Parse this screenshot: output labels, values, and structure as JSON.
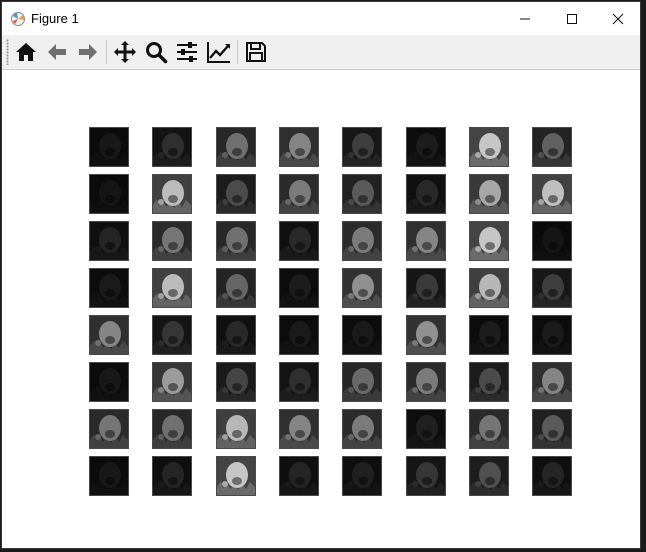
{
  "window": {
    "title": "Figure 1"
  },
  "toolbar": {
    "buttons": [
      {
        "name": "home-icon"
      },
      {
        "name": "back-arrow-icon"
      },
      {
        "name": "forward-arrow-icon"
      },
      {
        "name": "pan-move-icon"
      },
      {
        "name": "zoom-magnifier-icon"
      },
      {
        "name": "configure-subplots-icon"
      },
      {
        "name": "edit-axes-line-icon"
      },
      {
        "name": "save-floppy-icon"
      }
    ]
  },
  "feature_maps": {
    "rows": 8,
    "cols": 8,
    "brightness": [
      [
        0.04,
        0.15,
        0.45,
        0.55,
        0.22,
        0.06,
        0.85,
        0.38
      ],
      [
        0.03,
        0.8,
        0.28,
        0.5,
        0.35,
        0.12,
        0.7,
        0.82
      ],
      [
        0.1,
        0.48,
        0.45,
        0.12,
        0.5,
        0.55,
        0.85,
        0.03
      ],
      [
        0.05,
        0.8,
        0.4,
        0.06,
        0.6,
        0.2,
        0.78,
        0.22
      ],
      [
        0.55,
        0.18,
        0.12,
        0.05,
        0.05,
        0.6,
        0.06,
        0.05
      ],
      [
        0.04,
        0.65,
        0.25,
        0.15,
        0.42,
        0.5,
        0.28,
        0.55
      ],
      [
        0.48,
        0.45,
        0.78,
        0.55,
        0.5,
        0.08,
        0.48,
        0.35
      ],
      [
        0.04,
        0.1,
        0.85,
        0.1,
        0.08,
        0.18,
        0.3,
        0.1
      ]
    ]
  },
  "colors": {
    "grid_border": "#4a4a4a",
    "background": "#ffffff",
    "toolbar_bg": "#f0f0f0"
  }
}
